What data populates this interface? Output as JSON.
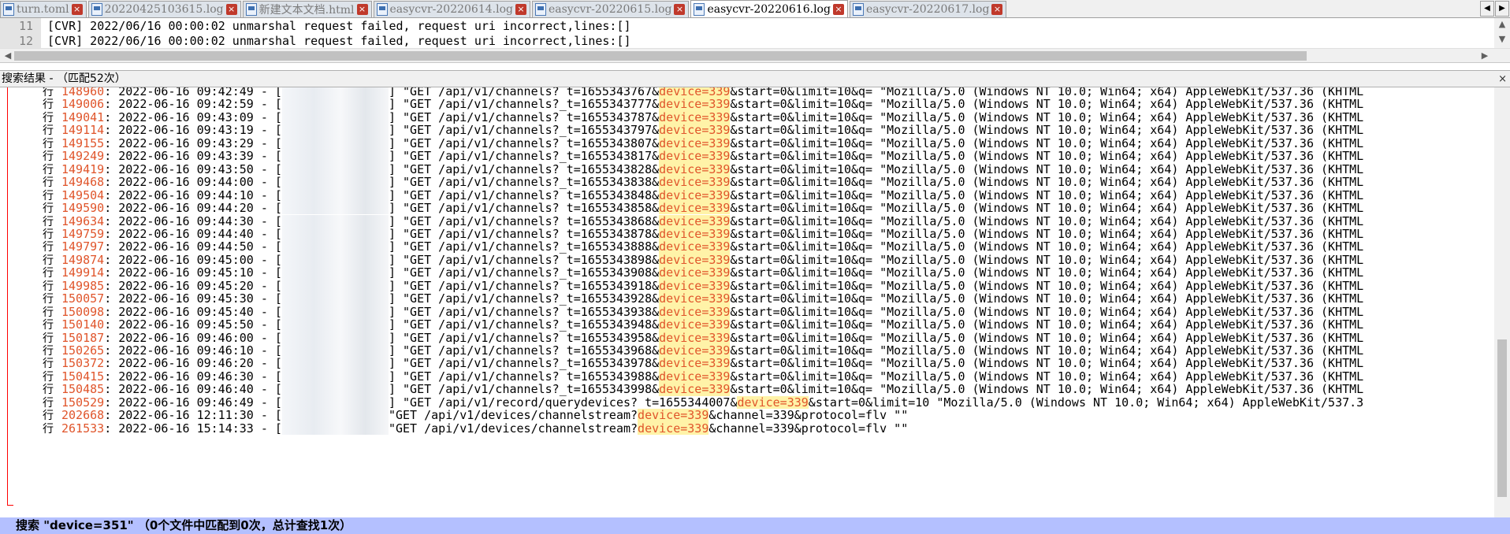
{
  "tabs": [
    {
      "label": "turn.toml",
      "active": false
    },
    {
      "label": "20220425103615.log",
      "active": false
    },
    {
      "label": "新建文本文档.html",
      "active": false
    },
    {
      "label": "easycvr-20220614.log",
      "active": false
    },
    {
      "label": "easycvr-20220615.log",
      "active": false
    },
    {
      "label": "easycvr-20220616.log",
      "active": true
    },
    {
      "label": "easycvr-20220617.log",
      "active": false
    }
  ],
  "tab_close_glyph": "×",
  "tab_nav": {
    "left": "◀",
    "right": "▶"
  },
  "editor_lines": [
    {
      "num": "11",
      "text": "[CVR] 2022/06/16 00:00:02 unmarshal request failed, request uri incorrect,lines:[]"
    },
    {
      "num": "12",
      "text": "[CVR] 2022/06/16 00:00:02 unmarshal request failed, request uri incorrect,lines:[]"
    }
  ],
  "search_panel": {
    "title": "搜索结果 - （匹配52次）",
    "close_glyph": "×"
  },
  "results": [
    {
      "hang": "行",
      "num": "148960",
      "time": ": 2022-06-16 09:42:49 - [",
      "pre": "] \"GET /api/v1/channels?_t=1655343767&",
      "match": "device=339",
      "post": "&start=0&limit=10&q= \"Mozilla/5.0 (Windows NT 10.0; Win64; x64) AppleWebKit/537.36 (KHTML"
    },
    {
      "hang": "行",
      "num": "149006",
      "time": ": 2022-06-16 09:42:59 - [",
      "pre": "] \"GET /api/v1/channels?_t=1655343777&",
      "match": "device=339",
      "post": "&start=0&limit=10&q= \"Mozilla/5.0 (Windows NT 10.0; Win64; x64) AppleWebKit/537.36 (KHTML"
    },
    {
      "hang": "行",
      "num": "149041",
      "time": ": 2022-06-16 09:43:09 - [",
      "pre": "] \"GET /api/v1/channels?_t=1655343787&",
      "match": "device=339",
      "post": "&start=0&limit=10&q= \"Mozilla/5.0 (Windows NT 10.0; Win64; x64) AppleWebKit/537.36 (KHTML"
    },
    {
      "hang": "行",
      "num": "149114",
      "time": ": 2022-06-16 09:43:19 - [",
      "pre": "] \"GET /api/v1/channels?_t=1655343797&",
      "match": "device=339",
      "post": "&start=0&limit=10&q= \"Mozilla/5.0 (Windows NT 10.0; Win64; x64) AppleWebKit/537.36 (KHTML"
    },
    {
      "hang": "行",
      "num": "149155",
      "time": ": 2022-06-16 09:43:29 - [",
      "pre": "] \"GET /api/v1/channels?_t=1655343807&",
      "match": "device=339",
      "post": "&start=0&limit=10&q= \"Mozilla/5.0 (Windows NT 10.0; Win64; x64) AppleWebKit/537.36 (KHTML"
    },
    {
      "hang": "行",
      "num": "149249",
      "time": ": 2022-06-16 09:43:39 - [",
      "pre": "] \"GET /api/v1/channels?_t=1655343817&",
      "match": "device=339",
      "post": "&start=0&limit=10&q= \"Mozilla/5.0 (Windows NT 10.0; Win64; x64) AppleWebKit/537.36 (KHTML"
    },
    {
      "hang": "行",
      "num": "149419",
      "time": ": 2022-06-16 09:43:50 - [",
      "pre": "] \"GET /api/v1/channels?_t=1655343828&",
      "match": "device=339",
      "post": "&start=0&limit=10&q= \"Mozilla/5.0 (Windows NT 10.0; Win64; x64) AppleWebKit/537.36 (KHTML"
    },
    {
      "hang": "行",
      "num": "149468",
      "time": ": 2022-06-16 09:44:00 - [",
      "pre": "] \"GET /api/v1/channels?_t=1655343838&",
      "match": "device=339",
      "post": "&start=0&limit=10&q= \"Mozilla/5.0 (Windows NT 10.0; Win64; x64) AppleWebKit/537.36 (KHTML"
    },
    {
      "hang": "行",
      "num": "149504",
      "time": ": 2022-06-16 09:44:10 - [",
      "pre": "] \"GET /api/v1/channels?_t=1655343848&",
      "match": "device=339",
      "post": "&start=0&limit=10&q= \"Mozilla/5.0 (Windows NT 10.0; Win64; x64) AppleWebKit/537.36 (KHTML"
    },
    {
      "hang": "行",
      "num": "149590",
      "time": ": 2022-06-16 09:44:20 - [",
      "pre": "] \"GET /api/v1/channels?_t=1655343858&",
      "match": "device=339",
      "post": "&start=0&limit=10&q= \"Mozilla/5.0 (Windows NT 10.0; Win64; x64) AppleWebKit/537.36 (KHTML"
    },
    {
      "hang": "行",
      "num": "149634",
      "time": ": 2022-06-16 09:44:30 - [",
      "pre": "] \"GET /api/v1/channels?_t=1655343868&",
      "match": "device=339",
      "post": "&start=0&limit=10&q= \"Mozilla/5.0 (Windows NT 10.0; Win64; x64) AppleWebKit/537.36 (KHTML"
    },
    {
      "hang": "行",
      "num": "149759",
      "time": ": 2022-06-16 09:44:40 - [",
      "pre": "] \"GET /api/v1/channels?_t=1655343878&",
      "match": "device=339",
      "post": "&start=0&limit=10&q= \"Mozilla/5.0 (Windows NT 10.0; Win64; x64) AppleWebKit/537.36 (KHTML"
    },
    {
      "hang": "行",
      "num": "149797",
      "time": ": 2022-06-16 09:44:50 - [",
      "pre": "] \"GET /api/v1/channels?_t=1655343888&",
      "match": "device=339",
      "post": "&start=0&limit=10&q= \"Mozilla/5.0 (Windows NT 10.0; Win64; x64) AppleWebKit/537.36 (KHTML"
    },
    {
      "hang": "行",
      "num": "149874",
      "time": ": 2022-06-16 09:45:00 - [",
      "pre": "] \"GET /api/v1/channels?_t=1655343898&",
      "match": "device=339",
      "post": "&start=0&limit=10&q= \"Mozilla/5.0 (Windows NT 10.0; Win64; x64) AppleWebKit/537.36 (KHTML"
    },
    {
      "hang": "行",
      "num": "149914",
      "time": ": 2022-06-16 09:45:10 - [",
      "pre": "] \"GET /api/v1/channels?_t=1655343908&",
      "match": "device=339",
      "post": "&start=0&limit=10&q= \"Mozilla/5.0 (Windows NT 10.0; Win64; x64) AppleWebKit/537.36 (KHTML"
    },
    {
      "hang": "行",
      "num": "149985",
      "time": ": 2022-06-16 09:45:20 - [",
      "pre": "] \"GET /api/v1/channels?_t=1655343918&",
      "match": "device=339",
      "post": "&start=0&limit=10&q= \"Mozilla/5.0 (Windows NT 10.0; Win64; x64) AppleWebKit/537.36 (KHTML"
    },
    {
      "hang": "行",
      "num": "150057",
      "time": ": 2022-06-16 09:45:30 - [",
      "pre": "] \"GET /api/v1/channels?_t=1655343928&",
      "match": "device=339",
      "post": "&start=0&limit=10&q= \"Mozilla/5.0 (Windows NT 10.0; Win64; x64) AppleWebKit/537.36 (KHTML"
    },
    {
      "hang": "行",
      "num": "150098",
      "time": ": 2022-06-16 09:45:40 - [",
      "pre": "] \"GET /api/v1/channels?_t=1655343938&",
      "match": "device=339",
      "post": "&start=0&limit=10&q= \"Mozilla/5.0 (Windows NT 10.0; Win64; x64) AppleWebKit/537.36 (KHTML"
    },
    {
      "hang": "行",
      "num": "150140",
      "time": ": 2022-06-16 09:45:50 - [",
      "pre": "] \"GET /api/v1/channels?_t=1655343948&",
      "match": "device=339",
      "post": "&start=0&limit=10&q= \"Mozilla/5.0 (Windows NT 10.0; Win64; x64) AppleWebKit/537.36 (KHTML"
    },
    {
      "hang": "行",
      "num": "150187",
      "time": ": 2022-06-16 09:46:00 - [",
      "pre": "] \"GET /api/v1/channels?_t=1655343958&",
      "match": "device=339",
      "post": "&start=0&limit=10&q= \"Mozilla/5.0 (Windows NT 10.0; Win64; x64) AppleWebKit/537.36 (KHTML"
    },
    {
      "hang": "行",
      "num": "150265",
      "time": ": 2022-06-16 09:46:10 - [",
      "pre": "] \"GET /api/v1/channels?_t=1655343968&",
      "match": "device=339",
      "post": "&start=0&limit=10&q= \"Mozilla/5.0 (Windows NT 10.0; Win64; x64) AppleWebKit/537.36 (KHTML"
    },
    {
      "hang": "行",
      "num": "150372",
      "time": ": 2022-06-16 09:46:20 - [",
      "pre": "] \"GET /api/v1/channels?_t=1655343978&",
      "match": "device=339",
      "post": "&start=0&limit=10&q= \"Mozilla/5.0 (Windows NT 10.0; Win64; x64) AppleWebKit/537.36 (KHTML"
    },
    {
      "hang": "行",
      "num": "150415",
      "time": ": 2022-06-16 09:46:30 - [",
      "pre": "] \"GET /api/v1/channels?_t=1655343988&",
      "match": "device=339",
      "post": "&start=0&limit=10&q= \"Mozilla/5.0 (Windows NT 10.0; Win64; x64) AppleWebKit/537.36 (KHTML"
    },
    {
      "hang": "行",
      "num": "150485",
      "time": ": 2022-06-16 09:46:40 - [",
      "pre": "] \"GET /api/v1/channels?_t=1655343998&",
      "match": "device=339",
      "post": "&start=0&limit=10&q= \"Mozilla/5.0 (Windows NT 10.0; Win64; x64) AppleWebKit/537.36 (KHTML"
    },
    {
      "hang": "行",
      "num": "150529",
      "time": ": 2022-06-16 09:46:49 - [",
      "pre": "] \"GET /api/v1/record/querydevices?_t=1655344007&",
      "match": "device=339",
      "post": "&start=0&limit=10 \"Mozilla/5.0 (Windows NT 10.0; Win64; x64) AppleWebKit/537.3"
    },
    {
      "hang": "行",
      "num": "202668",
      "time": ": 2022-06-16 12:11:30 - [",
      "pre": "\"GET /api/v1/devices/channelstream?",
      "match": "device=339",
      "post": "&channel=339&protocol=flv \"\""
    },
    {
      "hang": "行",
      "num": "261533",
      "time": ": 2022-06-16 15:14:33 - [",
      "pre": "\"GET /api/v1/devices/channelstream?",
      "match": "device=339",
      "post": "&channel=339&protocol=flv \"\""
    }
  ],
  "footer_text": "搜索 \"device=351\" （0个文件中匹配到0次，总计查找1次）",
  "icons": {
    "tab_file": "log-file-icon",
    "tab_close": "close-icon",
    "scroll_left": "chevron-left-icon",
    "scroll_right": "chevron-right-icon",
    "scroll_up": "chevron-up-icon",
    "scroll_down": "chevron-down-icon"
  },
  "colors": {
    "match_text": "#e0552b",
    "match_bg": "#fff3a8",
    "line_number": "#e0552b",
    "footer_bg": "#b4c0ff",
    "tab_close": "#c0392b"
  }
}
